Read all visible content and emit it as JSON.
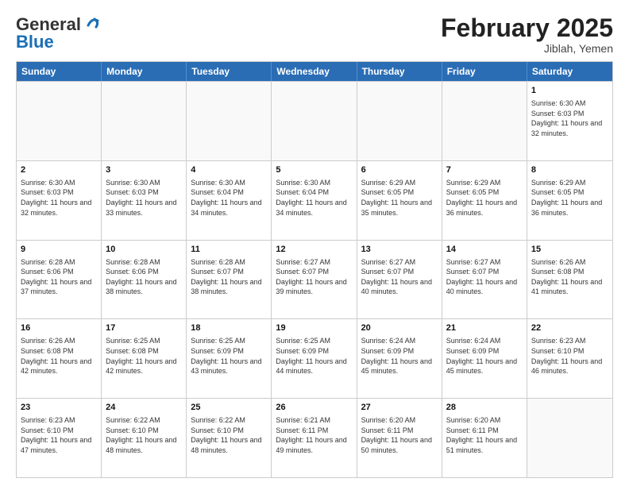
{
  "logo": {
    "line1": "General",
    "line2": "Blue"
  },
  "title": "February 2025",
  "subtitle": "Jiblah, Yemen",
  "days": [
    "Sunday",
    "Monday",
    "Tuesday",
    "Wednesday",
    "Thursday",
    "Friday",
    "Saturday"
  ],
  "weeks": [
    [
      {
        "day": "",
        "info": ""
      },
      {
        "day": "",
        "info": ""
      },
      {
        "day": "",
        "info": ""
      },
      {
        "day": "",
        "info": ""
      },
      {
        "day": "",
        "info": ""
      },
      {
        "day": "",
        "info": ""
      },
      {
        "day": "1",
        "info": "Sunrise: 6:30 AM\nSunset: 6:03 PM\nDaylight: 11 hours and 32 minutes."
      }
    ],
    [
      {
        "day": "2",
        "info": "Sunrise: 6:30 AM\nSunset: 6:03 PM\nDaylight: 11 hours and 32 minutes."
      },
      {
        "day": "3",
        "info": "Sunrise: 6:30 AM\nSunset: 6:03 PM\nDaylight: 11 hours and 33 minutes."
      },
      {
        "day": "4",
        "info": "Sunrise: 6:30 AM\nSunset: 6:04 PM\nDaylight: 11 hours and 34 minutes."
      },
      {
        "day": "5",
        "info": "Sunrise: 6:30 AM\nSunset: 6:04 PM\nDaylight: 11 hours and 34 minutes."
      },
      {
        "day": "6",
        "info": "Sunrise: 6:29 AM\nSunset: 6:05 PM\nDaylight: 11 hours and 35 minutes."
      },
      {
        "day": "7",
        "info": "Sunrise: 6:29 AM\nSunset: 6:05 PM\nDaylight: 11 hours and 36 minutes."
      },
      {
        "day": "8",
        "info": "Sunrise: 6:29 AM\nSunset: 6:05 PM\nDaylight: 11 hours and 36 minutes."
      }
    ],
    [
      {
        "day": "9",
        "info": "Sunrise: 6:28 AM\nSunset: 6:06 PM\nDaylight: 11 hours and 37 minutes."
      },
      {
        "day": "10",
        "info": "Sunrise: 6:28 AM\nSunset: 6:06 PM\nDaylight: 11 hours and 38 minutes."
      },
      {
        "day": "11",
        "info": "Sunrise: 6:28 AM\nSunset: 6:07 PM\nDaylight: 11 hours and 38 minutes."
      },
      {
        "day": "12",
        "info": "Sunrise: 6:27 AM\nSunset: 6:07 PM\nDaylight: 11 hours and 39 minutes."
      },
      {
        "day": "13",
        "info": "Sunrise: 6:27 AM\nSunset: 6:07 PM\nDaylight: 11 hours and 40 minutes."
      },
      {
        "day": "14",
        "info": "Sunrise: 6:27 AM\nSunset: 6:07 PM\nDaylight: 11 hours and 40 minutes."
      },
      {
        "day": "15",
        "info": "Sunrise: 6:26 AM\nSunset: 6:08 PM\nDaylight: 11 hours and 41 minutes."
      }
    ],
    [
      {
        "day": "16",
        "info": "Sunrise: 6:26 AM\nSunset: 6:08 PM\nDaylight: 11 hours and 42 minutes."
      },
      {
        "day": "17",
        "info": "Sunrise: 6:25 AM\nSunset: 6:08 PM\nDaylight: 11 hours and 42 minutes."
      },
      {
        "day": "18",
        "info": "Sunrise: 6:25 AM\nSunset: 6:09 PM\nDaylight: 11 hours and 43 minutes."
      },
      {
        "day": "19",
        "info": "Sunrise: 6:25 AM\nSunset: 6:09 PM\nDaylight: 11 hours and 44 minutes."
      },
      {
        "day": "20",
        "info": "Sunrise: 6:24 AM\nSunset: 6:09 PM\nDaylight: 11 hours and 45 minutes."
      },
      {
        "day": "21",
        "info": "Sunrise: 6:24 AM\nSunset: 6:09 PM\nDaylight: 11 hours and 45 minutes."
      },
      {
        "day": "22",
        "info": "Sunrise: 6:23 AM\nSunset: 6:10 PM\nDaylight: 11 hours and 46 minutes."
      }
    ],
    [
      {
        "day": "23",
        "info": "Sunrise: 6:23 AM\nSunset: 6:10 PM\nDaylight: 11 hours and 47 minutes."
      },
      {
        "day": "24",
        "info": "Sunrise: 6:22 AM\nSunset: 6:10 PM\nDaylight: 11 hours and 48 minutes."
      },
      {
        "day": "25",
        "info": "Sunrise: 6:22 AM\nSunset: 6:10 PM\nDaylight: 11 hours and 48 minutes."
      },
      {
        "day": "26",
        "info": "Sunrise: 6:21 AM\nSunset: 6:11 PM\nDaylight: 11 hours and 49 minutes."
      },
      {
        "day": "27",
        "info": "Sunrise: 6:20 AM\nSunset: 6:11 PM\nDaylight: 11 hours and 50 minutes."
      },
      {
        "day": "28",
        "info": "Sunrise: 6:20 AM\nSunset: 6:11 PM\nDaylight: 11 hours and 51 minutes."
      },
      {
        "day": "",
        "info": ""
      }
    ]
  ]
}
